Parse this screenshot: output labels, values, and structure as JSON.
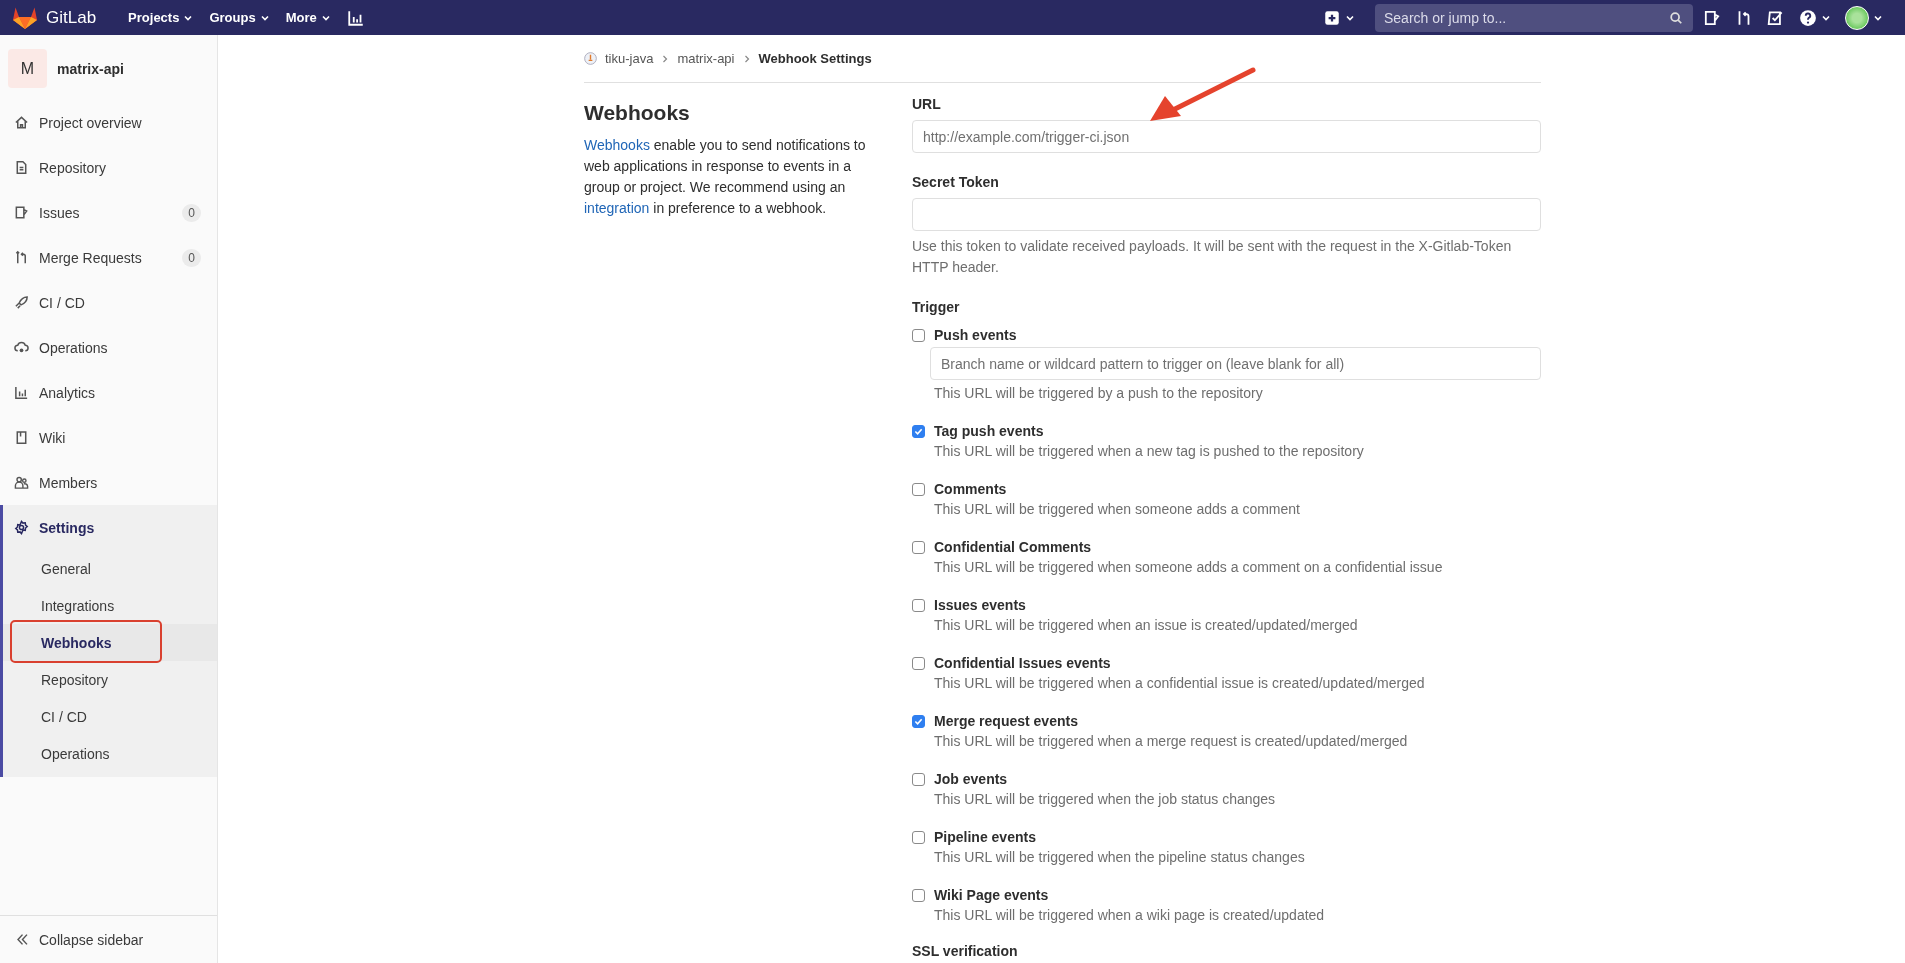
{
  "topbar": {
    "brand": "GitLab",
    "nav": [
      {
        "label": "Projects"
      },
      {
        "label": "Groups"
      },
      {
        "label": "More"
      }
    ],
    "search": {
      "placeholder": "Search or jump to..."
    }
  },
  "sidebar": {
    "project": {
      "avatar": "M",
      "name": "matrix-api"
    },
    "items": [
      {
        "label": "Project overview",
        "selected": false
      },
      {
        "label": "Repository",
        "selected": false
      },
      {
        "label": "Issues",
        "count": "0",
        "selected": false
      },
      {
        "label": "Merge Requests",
        "count": "0",
        "selected": false
      },
      {
        "label": "CI / CD",
        "selected": false
      },
      {
        "label": "Operations",
        "selected": false
      },
      {
        "label": "Analytics",
        "selected": false
      },
      {
        "label": "Wiki",
        "selected": false
      },
      {
        "label": "Members",
        "selected": false
      },
      {
        "label": "Settings",
        "selected": true,
        "expanded": true,
        "children": [
          {
            "label": "General",
            "selected": false
          },
          {
            "label": "Integrations",
            "selected": false
          },
          {
            "label": "Webhooks",
            "selected": true
          },
          {
            "label": "Repository",
            "selected": false
          },
          {
            "label": "CI / CD",
            "selected": false
          },
          {
            "label": "Operations",
            "selected": false
          }
        ]
      }
    ],
    "collapse": "Collapse sidebar"
  },
  "breadcrumbs": [
    {
      "label": "tiku-java"
    },
    {
      "label": "matrix-api"
    },
    {
      "label": "Webhook Settings"
    }
  ],
  "intro": {
    "title": "Webhooks",
    "description": [
      {
        "kind": "link",
        "text": "Webhooks"
      },
      {
        "kind": "text",
        "text": " enable you to send notifications to web applications in response to events in a group or project. We recommend using an "
      },
      {
        "kind": "link",
        "text": "integration"
      },
      {
        "kind": "text",
        "text": " in preference to a webhook."
      }
    ]
  },
  "form": {
    "url": {
      "label": "URL",
      "placeholder": "http://example.com/trigger-ci.json"
    },
    "secret_token": {
      "label": "Secret Token",
      "help": "Use this token to validate received payloads. It will be sent with the request in the X-Gitlab-Token HTTP header."
    },
    "trigger": {
      "label": "Trigger",
      "events": [
        {
          "label": "Push events",
          "checked": false,
          "branch_placeholder": "Branch name or wildcard pattern to trigger on (leave blank for all)",
          "help": "This URL will be triggered by a push to the repository"
        },
        {
          "label": "Tag push events",
          "checked": true,
          "help": "This URL will be triggered when a new tag is pushed to the repository"
        },
        {
          "label": "Comments",
          "checked": false,
          "help": "This URL will be triggered when someone adds a comment"
        },
        {
          "label": "Confidential Comments",
          "checked": false,
          "help": "This URL will be triggered when someone adds a comment on a confidential issue"
        },
        {
          "label": "Issues events",
          "checked": false,
          "help": "This URL will be triggered when an issue is created/updated/merged"
        },
        {
          "label": "Confidential Issues events",
          "checked": false,
          "help": "This URL will be triggered when a confidential issue is created/updated/merged"
        },
        {
          "label": "Merge request events",
          "checked": true,
          "help": "This URL will be triggered when a merge request is created/updated/merged"
        },
        {
          "label": "Job events",
          "checked": false,
          "help": "This URL will be triggered when the job status changes"
        },
        {
          "label": "Pipeline events",
          "checked": false,
          "help": "This URL will be triggered when the pipeline status changes"
        },
        {
          "label": "Wiki Page events",
          "checked": false,
          "help": "This URL will be triggered when a wiki page is created/updated"
        }
      ]
    },
    "ssl_verification": {
      "label": "SSL verification"
    }
  }
}
